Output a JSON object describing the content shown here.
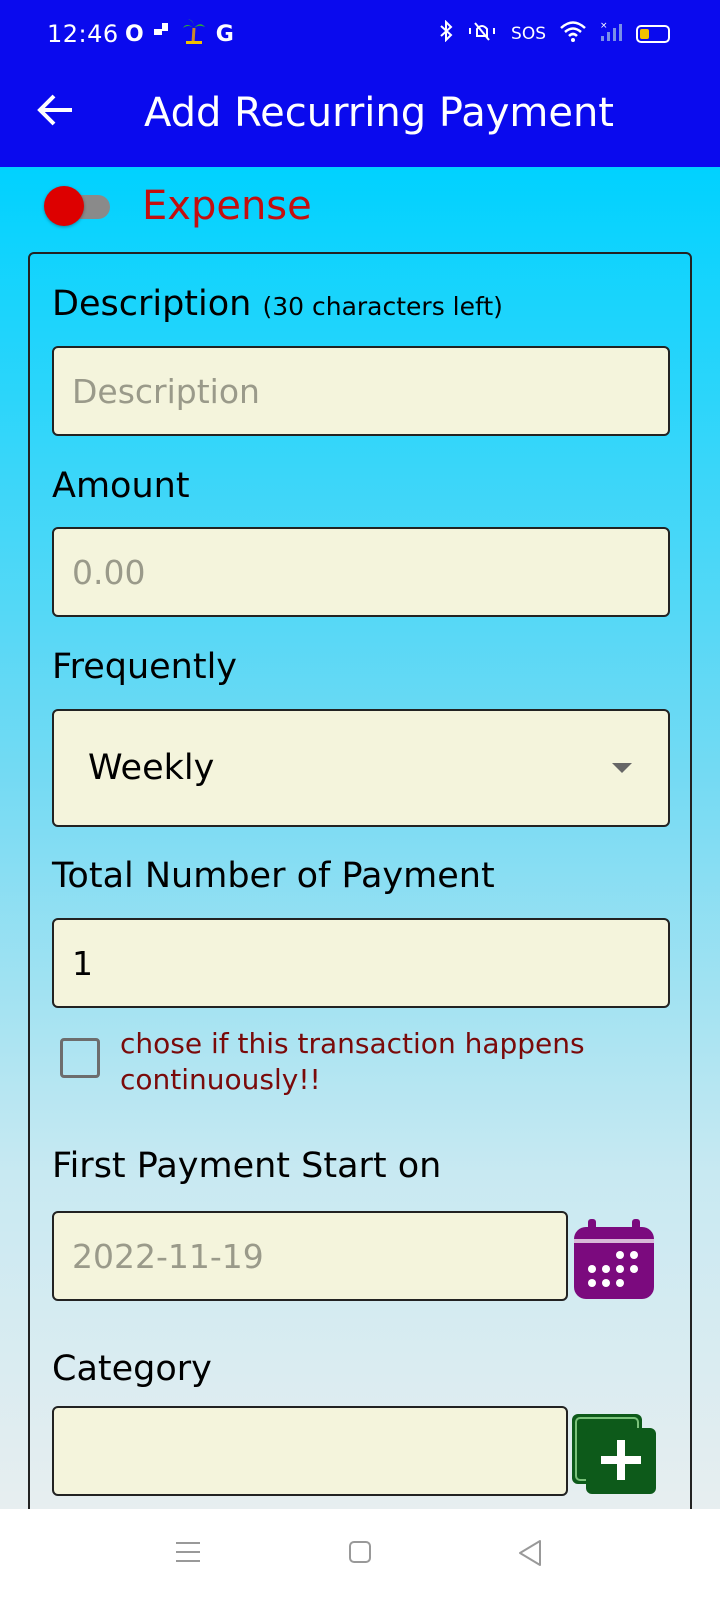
{
  "status_bar": {
    "time": "12:46",
    "left_icons": [
      "opera-icon",
      "notification-icon",
      "palm-tree-icon",
      "google-icon"
    ],
    "g_letter": "G",
    "o_letter": "O",
    "sos": "SOS"
  },
  "app_bar": {
    "title": "Add Recurring Payment"
  },
  "type_toggle": {
    "label": "Expense",
    "state": "off",
    "thumb_color": "#dd0000"
  },
  "form": {
    "description": {
      "label": "Description",
      "hint": "(30 characters left)",
      "placeholder": "Description",
      "value": ""
    },
    "amount": {
      "label": "Amount",
      "placeholder": "0.00",
      "value": ""
    },
    "frequency": {
      "label": "Frequently",
      "selected": "Weekly"
    },
    "total_payments": {
      "label": "Total Number of Payment",
      "value": "1"
    },
    "continuous": {
      "label": "chose if this transaction happens continuously!!",
      "checked": false
    },
    "start_date": {
      "label": "First Payment Start on",
      "placeholder": "2022-11-19",
      "value": ""
    },
    "category": {
      "label": "Category",
      "value": ""
    }
  },
  "colors": {
    "app_bar": "#0a0aee",
    "field_bg": "#f4f4dc",
    "warning_text": "#7a0a0a",
    "calendar_button": "#7b0a7e",
    "add_button": "#0d5a1a"
  }
}
